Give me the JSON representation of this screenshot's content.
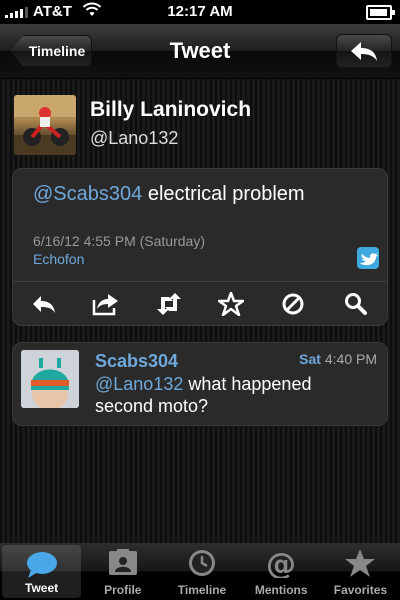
{
  "status_bar": {
    "carrier": "AT&T",
    "time": "12:17 AM"
  },
  "nav": {
    "back_label": "Timeline",
    "title": "Tweet"
  },
  "author": {
    "name": "Billy Laninovich",
    "handle": "@Lano132"
  },
  "tweet": {
    "mention": "@Scabs304",
    "text": " electrical problem",
    "date": "6/16/12 4:55 PM (Saturday)",
    "source": "Echofon"
  },
  "actions": [
    "reply-icon",
    "share-icon",
    "retweet-icon",
    "favorite-star-icon",
    "block-icon",
    "search-icon"
  ],
  "reply": {
    "name": "Scabs304",
    "day": "Sat",
    "time": " 4:40 PM",
    "mention": "@Lano132",
    "text": " what happened second moto?"
  },
  "tabs": [
    {
      "label": "Tweet",
      "icon": "speech-bubble-icon"
    },
    {
      "label": "Profile",
      "icon": "profile-card-icon"
    },
    {
      "label": "Timeline",
      "icon": "clock-icon"
    },
    {
      "label": "Mentions",
      "icon": "at-sign-icon"
    },
    {
      "label": "Favorites",
      "icon": "star-icon"
    }
  ],
  "colors": {
    "link": "#6fa8dc",
    "background": "#151515",
    "card": "#2a2a2a"
  }
}
